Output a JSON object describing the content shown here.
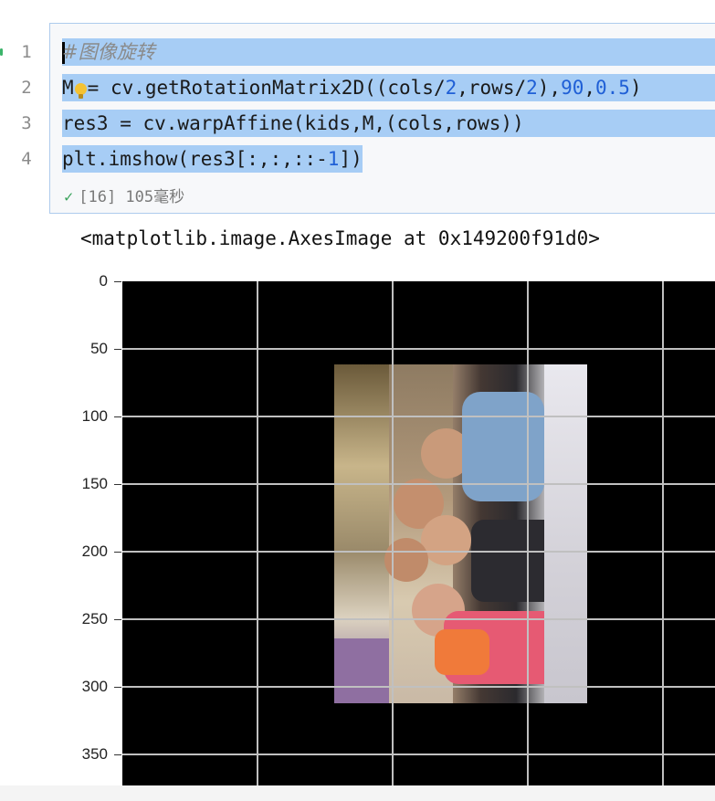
{
  "cell": {
    "line_numbers": [
      "1",
      "2",
      "3",
      "4"
    ],
    "code": {
      "line1_comment": "#图像旋转",
      "line2_a": "M",
      "line2_b": "= cv.getRotationMatrix2D((cols/",
      "line2_n1": "2",
      "line2_c": ",rows/",
      "line2_n2": "2",
      "line2_d": "),",
      "line2_n3": "90",
      "line2_e": ",",
      "line2_n4": "0.5",
      "line2_f": ")",
      "line3": "res3 = cv.warpAffine(kids,M,(cols,rows))",
      "line4_a": "plt.imshow(res3[:,:,::-",
      "line4_n": "1",
      "line4_b": "])"
    },
    "status": {
      "icon": "check-icon",
      "text": "[16] 105毫秒"
    }
  },
  "output": {
    "repr": "<matplotlib.image.AxesImage at 0x149200f91d0>"
  },
  "chart_data": {
    "type": "image",
    "y_ticks": [
      "0",
      "50",
      "100",
      "150",
      "200",
      "250",
      "300",
      "350"
    ],
    "ylim": [
      0,
      372
    ],
    "grid": true,
    "image_description_colors": {
      "background": "#000000",
      "grid": "#bfbfbf"
    }
  }
}
